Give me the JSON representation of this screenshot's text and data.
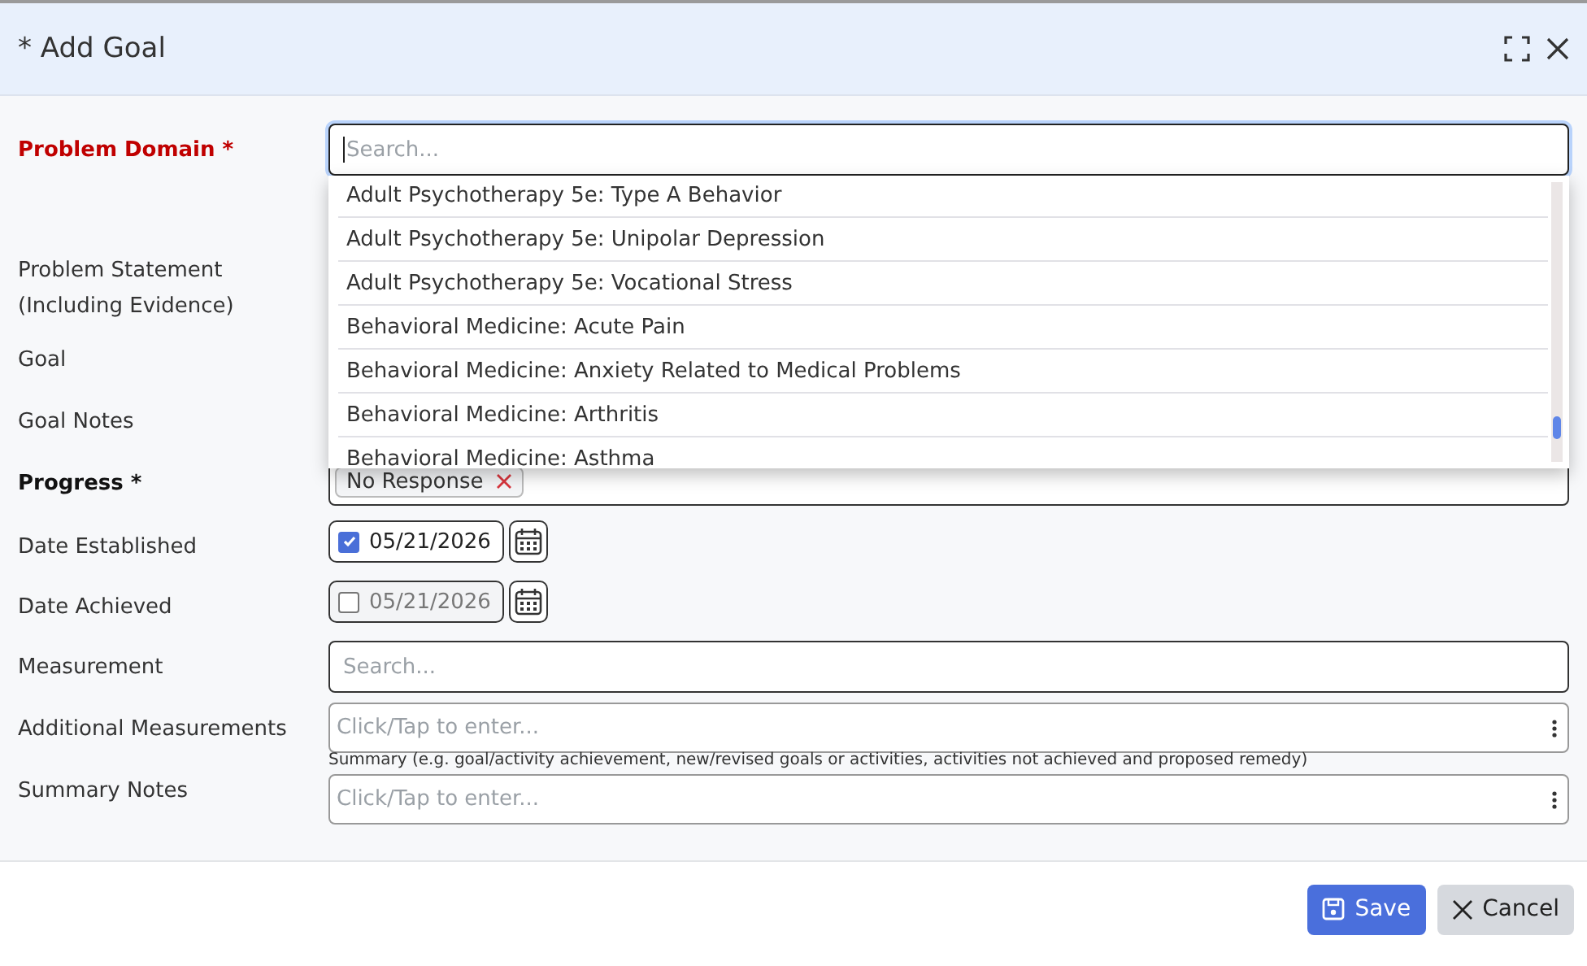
{
  "dialog": {
    "title": "* Add Goal"
  },
  "fields": [
    {
      "kind": "combo",
      "label": "Problem Domain *",
      "required": true,
      "error": true,
      "placeholder": "Search...",
      "options": [
        "Adult Psychotherapy 5e: Type A Behavior",
        "Adult Psychotherapy 5e: Unipolar Depression",
        "Adult Psychotherapy 5e: Vocational Stress",
        "Behavioral Medicine: Acute Pain",
        "Behavioral Medicine: Anxiety Related to Medical Problems",
        "Behavioral Medicine: Arthritis",
        "Behavioral Medicine: Asthma"
      ]
    },
    {
      "kind": "covered",
      "label": "Problem Statement (Including Evidence)",
      "required": false,
      "error": false
    },
    {
      "kind": "covered",
      "label": "Goal",
      "required": false,
      "error": false
    },
    {
      "kind": "covered",
      "label": "Goal Notes",
      "required": false,
      "error": false
    },
    {
      "kind": "tags",
      "label": "Progress *",
      "required": true,
      "error": false,
      "tags": [
        "No Response"
      ]
    },
    {
      "kind": "date",
      "label": "Date Established",
      "required": false,
      "error": false,
      "checked": true,
      "value": "05/21/2026"
    },
    {
      "kind": "date",
      "label": "Date Achieved",
      "required": false,
      "error": false,
      "checked": false,
      "value": "05/21/2026"
    },
    {
      "kind": "search",
      "label": "Measurement",
      "required": false,
      "error": false,
      "placeholder": "Search..."
    },
    {
      "kind": "text",
      "label": "Additional Measurements",
      "required": false,
      "error": false,
      "placeholder": "Click/Tap to enter..."
    },
    {
      "kind": "text",
      "label": "Summary Notes",
      "required": false,
      "error": false,
      "caption": "Summary (e.g. goal/activity achievement, new/revised goals or activities, activities not achieved and proposed remedy)",
      "placeholder": "Click/Tap to enter..."
    }
  ],
  "buttons": [
    {
      "label": "Save",
      "kind": "primary"
    },
    {
      "label": "Cancel",
      "kind": "secondary"
    }
  ]
}
